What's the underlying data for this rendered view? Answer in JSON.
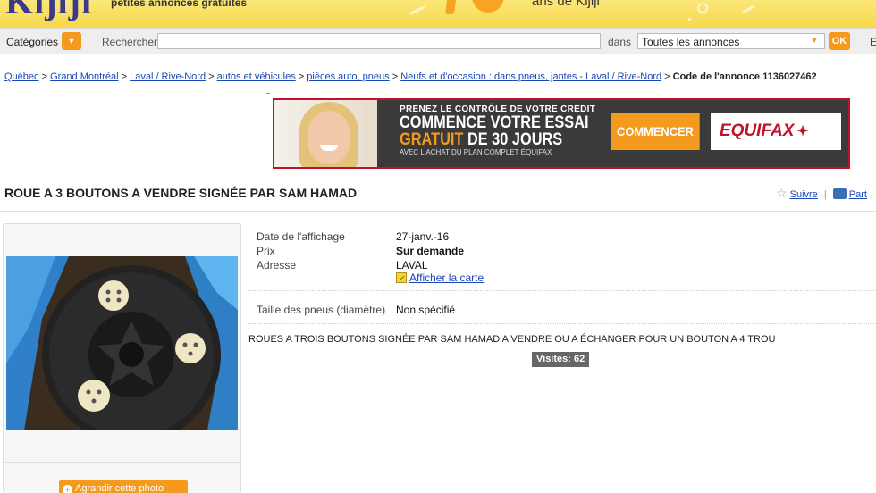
{
  "header": {
    "logo": "Kijiji",
    "tagline": "petites annonces gratuites",
    "anniversary": "ans de Kijiji"
  },
  "searchbar": {
    "categories_label": "Catégories",
    "search_label": "Rechercher",
    "search_value": "",
    "in_label": "dans",
    "scope_value": "Toutes les annonces",
    "ok_label": "OK",
    "extra_label": "E"
  },
  "breadcrumb": {
    "items": [
      "Québec",
      "Grand Montréal",
      "Laval / Rive-Nord",
      "autos et véhicules",
      "pièces auto, pneus",
      "Neufs et d'occasion : dans pneus, jantes - Laval / Rive-Nord"
    ],
    "separator": ">",
    "final": "Code de l'annonce 1136027462"
  },
  "ad": {
    "line1": "PRENEZ LE CONTRÔLE DE VOTRE CRÉDIT",
    "line2": "COMMENCE VOTRE ESSAI",
    "line3_highlight": "GRATUIT",
    "line3_rest": " DE 30 JOURS",
    "line4": "AVEC L'ACHAT DU PLAN COMPLET ÉQUIFAX",
    "cta": "COMMENCER",
    "brand": "EQUIFAX"
  },
  "listing": {
    "title": "ROUE A 3 BOUTONS A VENDRE SIGNÉE PAR SAM HAMAD",
    "follow": "Suivre",
    "share": "Part",
    "enlarge_photo": "Agrandir cette photo",
    "date_label": "Date de l'affichage",
    "date_value": "27-janv.-16",
    "price_label": "Prix",
    "price_value": "Sur demande",
    "address_label": "Adresse",
    "address_value": "LAVAL",
    "map_link": "Afficher la carte",
    "tire_label": "Taille des pneus (diamètre)",
    "tire_value": "Non spécifié",
    "description": "ROUES A TROIS BOUTONS SIGNÉE PAR SAM HAMAD A VENDRE OU A ÉCHANGER POUR UN BOUTON A 4 TROU",
    "visits": "Visites: 62"
  },
  "colors": {
    "accent": "#f39a1f",
    "link": "#1a46b8",
    "header_yellow": "#f7d84a",
    "ad_border": "#c0122c"
  },
  "icons": [
    "chevron-down-icon",
    "star-icon",
    "share-icon",
    "map-icon",
    "magnify-icon"
  ]
}
